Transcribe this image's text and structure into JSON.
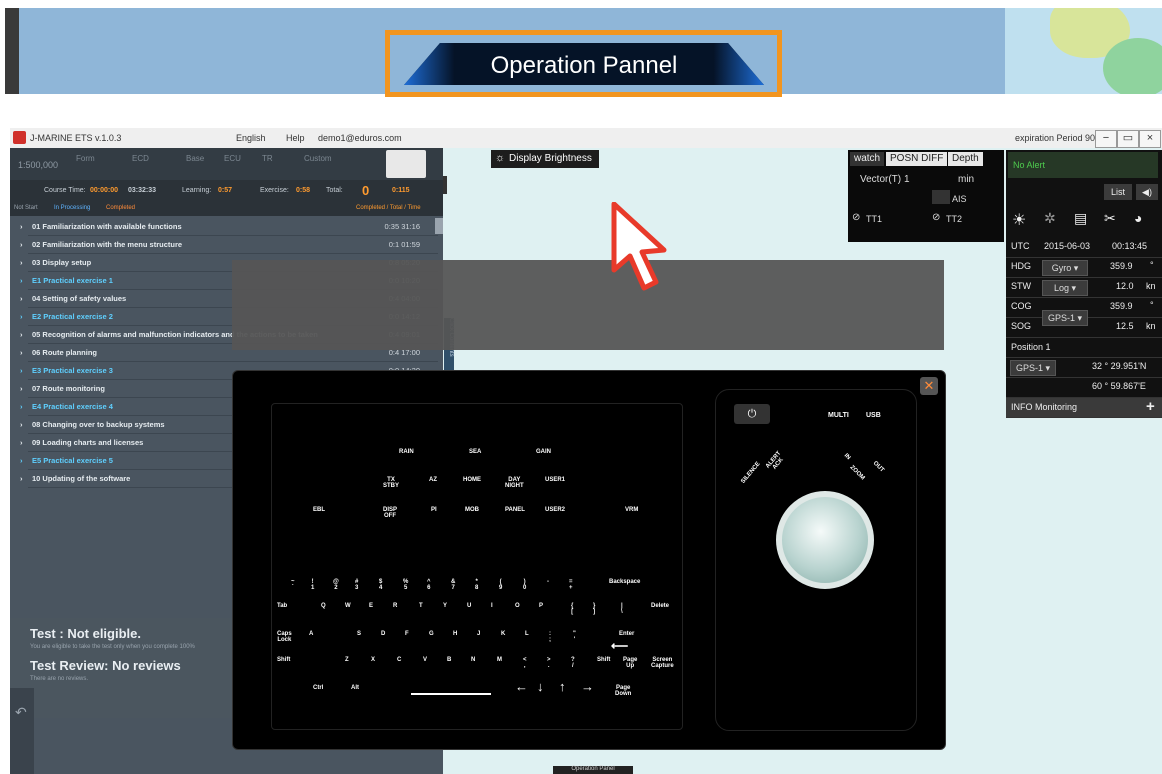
{
  "banner": {
    "title": "Operation Pannel"
  },
  "app": {
    "title": "J-MARINE ETS v.1.0.3",
    "menu": [
      "English",
      "Help",
      "demo1@eduros.com"
    ],
    "expiration": "expiration Period 90",
    "window_controls": [
      "−",
      "▭",
      "×"
    ]
  },
  "left": {
    "scale": "1:500,000",
    "tabs": [
      "Form",
      "ECD",
      "Base",
      "ECU",
      "TR",
      "Custom"
    ],
    "stats": {
      "course_time_label": "Course Time:",
      "course_time": "00:00:00",
      "elapsed": "03:32:33",
      "learning_label": "Learning:",
      "learning": "0:57",
      "exercise_label": "Exercise:",
      "exercise": "0:58",
      "total_label": "Total:",
      "completed": "0",
      "total": "0:115"
    },
    "legend": {
      "not_start": "Not Start",
      "processing": "In Processing",
      "completed": "Completed",
      "right": "Completed / Total / Time"
    },
    "rows": [
      {
        "label": "01 Familiarization with available functions",
        "num": "0:35 31:16",
        "ex": false
      },
      {
        "label": "02 Familiarization with the menu structure",
        "num": "0:1 01:59",
        "ex": false
      },
      {
        "label": "03 Display setup",
        "num": "0:8 05:20",
        "ex": false
      },
      {
        "label": "E1 Practical exercise 1",
        "num": "0:0 10:20",
        "ex": true
      },
      {
        "label": "04 Setting of safety values",
        "num": "0:4 04:00",
        "ex": false
      },
      {
        "label": "E2 Practical exercise 2",
        "num": "0:0 14:12",
        "ex": true
      },
      {
        "label": "05 Recognition of alarms and malfunction indicators and the actions to be taken",
        "num": "0:4 09:01",
        "ex": false
      },
      {
        "label": "06 Route planning",
        "num": "0:4 17:00",
        "ex": false
      },
      {
        "label": "E3 Practical exercise 3",
        "num": "0:0 14:20",
        "ex": true
      },
      {
        "label": "07 Route monitoring",
        "num": "",
        "ex": false
      },
      {
        "label": "E4 Practical exercise 4",
        "num": "",
        "ex": true
      },
      {
        "label": "08 Changing over to backup systems",
        "num": "",
        "ex": false
      },
      {
        "label": "09 Loading charts and licenses",
        "num": "",
        "ex": false
      },
      {
        "label": "E5 Practical exercise 5",
        "num": "",
        "ex": true
      },
      {
        "label": "10 Updating of the software",
        "num": "",
        "ex": false
      }
    ],
    "test_title": "Test : Not eligible.",
    "test_sub": "You are eligible to take the test only when you complete 100%",
    "review_title": "Test Review: No reviews",
    "review_sub": "There are no reviews.",
    "side_tab": "Click Contents"
  },
  "map": {
    "display_brightness": "Display Brightness",
    "vector_tabs": [
      "watch",
      "POSN DIFF",
      "Depth"
    ],
    "vector_label": "Vector(T)",
    "vector_value": "1",
    "vector_unit": "min",
    "ais": "AIS",
    "tt1": "TT1",
    "tt2": "TT2",
    "bottom_label": "Operation Panel"
  },
  "nav": {
    "alert": "No Alert",
    "list": "List",
    "utc_label": "UTC",
    "date": "2015-06-03",
    "time": "00:13:45",
    "hdg_label": "HDG",
    "hdg_src": "Gyro",
    "hdg": "359.9",
    "hdg_unit": "°",
    "stw_label": "STW",
    "stw_src": "Log",
    "stw": "12.0",
    "stw_unit": "kn",
    "cog_label": "COG",
    "cog": "359.9",
    "cog_unit": "°",
    "sog_label": "SOG",
    "sog_src": "GPS-1",
    "sog": "12.5",
    "sog_unit": "kn",
    "position_label": "Position 1",
    "pos_src": "GPS-1",
    "lat": "32 ° 29.951'N",
    "lon": "60 ° 59.867'E",
    "info": "INFO Monitoring"
  },
  "keyboard": {
    "top_row1": [
      "RAIN",
      "SEA",
      "GAIN"
    ],
    "top_row2": [
      "TX\nSTBY",
      "AZ",
      "HOME",
      "DAY\nNIGHT",
      "USER1"
    ],
    "top_row3": [
      "EBL",
      "DISP\nOFF",
      "PI",
      "MOB",
      "PANEL",
      "USER2",
      "VRM"
    ],
    "num_row": [
      "~\n`",
      "!\n1",
      "@\n2",
      "#\n3",
      "$\n4",
      "%\n5",
      "^\n6",
      "&\n7",
      "*\n8",
      "(\n9",
      ")\n0",
      "-",
      "=\n+",
      "Backspace"
    ],
    "q_row": [
      "Tab",
      "Q",
      "W",
      "E",
      "R",
      "T",
      "Y",
      "U",
      "I",
      "O",
      "P",
      "{\n[",
      "}\n]",
      "|\n\\",
      "Delete"
    ],
    "a_row": [
      "Caps\nLock",
      "A",
      "S",
      "D",
      "F",
      "G",
      "H",
      "J",
      "K",
      "L",
      ":\n;",
      "\"\n'",
      "Enter"
    ],
    "z_row": [
      "Shift",
      "Z",
      "X",
      "C",
      "V",
      "B",
      "N",
      "M",
      "<\n,",
      ">\n.",
      "?\n/",
      "Shift",
      "Page\nUp",
      "Screen\nCapture"
    ],
    "bottom_row": [
      "Ctrl",
      "Alt",
      "Page\nDown"
    ],
    "right_panel": {
      "multi": "MULTI",
      "usb": "USB",
      "silence": "SILENCE",
      "alert_ack": "ALERT\nACK",
      "in": "IN",
      "zoom": "ZOOM",
      "out": "OUT"
    },
    "close_icon": "close-icon"
  }
}
